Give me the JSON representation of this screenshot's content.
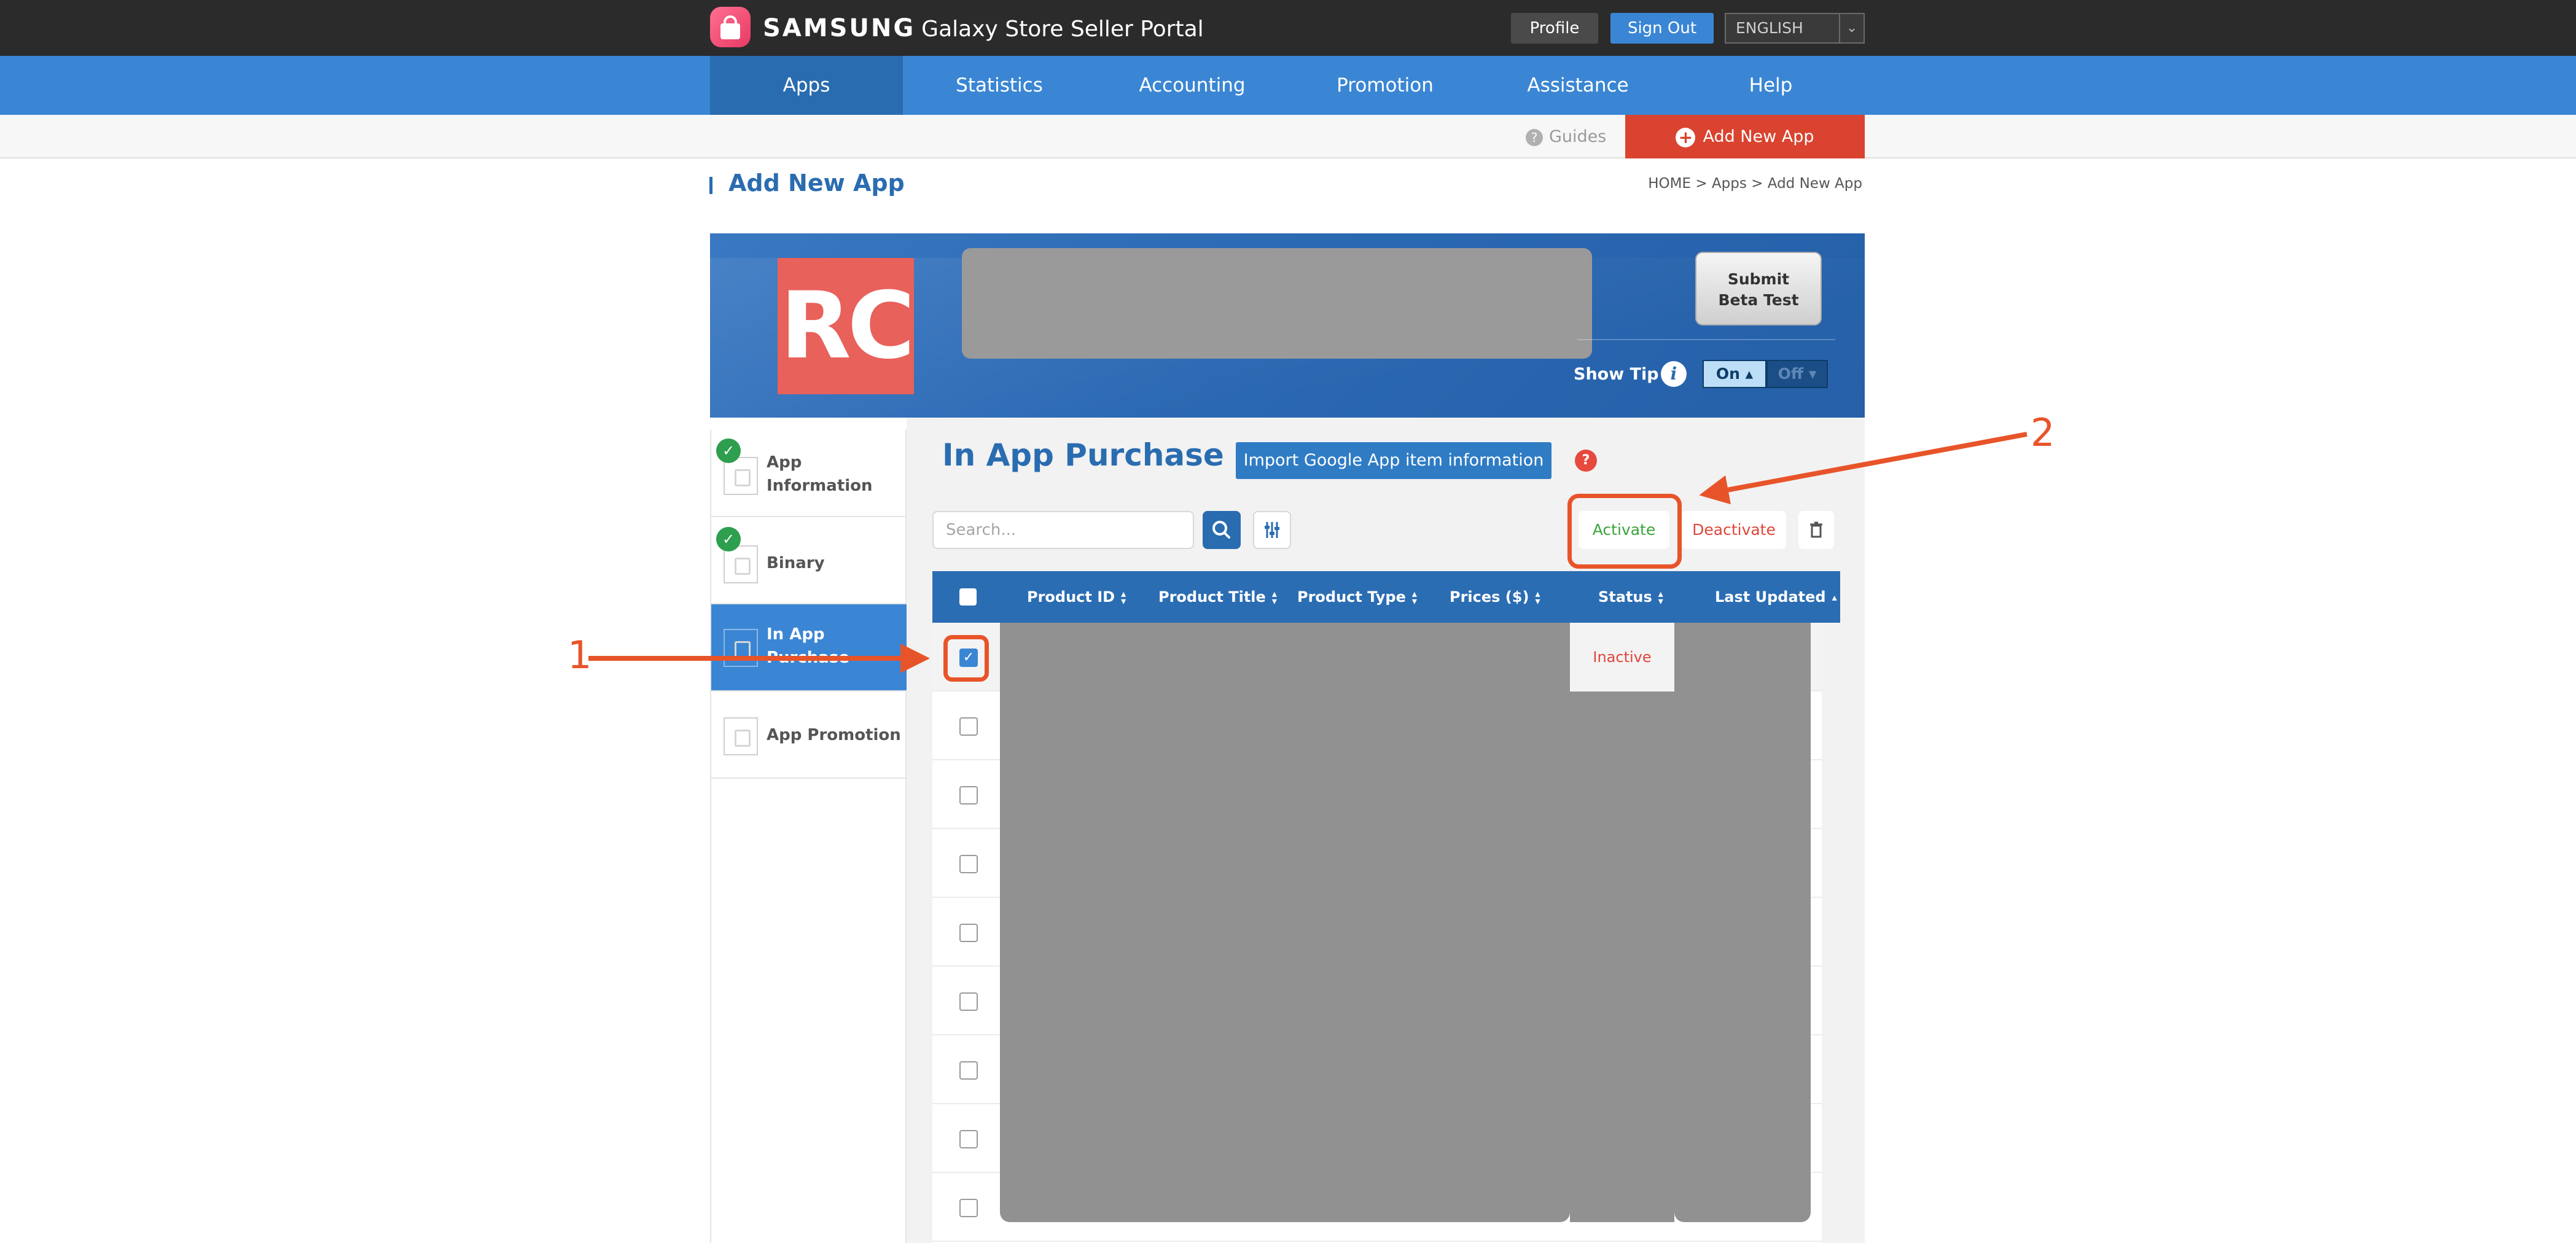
{
  "brand": {
    "samsung": "SAMSUNG",
    "rest": "Galaxy Store Seller Portal"
  },
  "topbar": {
    "profile": "Profile",
    "sign_out": "Sign Out",
    "language": "ENGLISH"
  },
  "nav": [
    "Apps",
    "Statistics",
    "Accounting",
    "Promotion",
    "Assistance",
    "Help"
  ],
  "subnav": {
    "guides": "Guides",
    "add_new_app": "Add New App"
  },
  "page": {
    "title": "Add New App",
    "breadcrumb": "HOME  >  Apps  >  Add New App"
  },
  "app_header": {
    "icon_text": "RC",
    "beta_test": [
      "Submit",
      "Beta Test"
    ],
    "show_tip": "Show Tip",
    "tip_on": "On ▴",
    "tip_off": "Off ▾"
  },
  "sidebar": {
    "items": [
      {
        "label": "App Information",
        "completed": true,
        "active": false
      },
      {
        "label": "Binary",
        "completed": true,
        "active": false
      },
      {
        "label": "In App Purchase",
        "completed": false,
        "active": true
      },
      {
        "label": "App Promotion",
        "completed": false,
        "active": false
      }
    ]
  },
  "iap": {
    "title": "In App Purchase",
    "import_btn": "Import Google App item information",
    "search_placeholder": "Search...",
    "activate": "Activate",
    "deactivate": "Deactivate",
    "columns": [
      "Product ID",
      "Product Title",
      "Product Type",
      "Prices ($)",
      "Status",
      "Last Updated"
    ],
    "rows": [
      {
        "checked": true,
        "status": "Inactive"
      },
      {
        "checked": false
      },
      {
        "checked": false
      },
      {
        "checked": false
      },
      {
        "checked": false
      },
      {
        "checked": false
      },
      {
        "checked": false
      },
      {
        "checked": false
      },
      {
        "checked": false
      }
    ]
  },
  "annotations": {
    "one": "1",
    "two": "2"
  },
  "colors": {
    "nav_blue": "#3a86d4",
    "annotation": "#e8542a",
    "add_new": "#d9432f"
  }
}
